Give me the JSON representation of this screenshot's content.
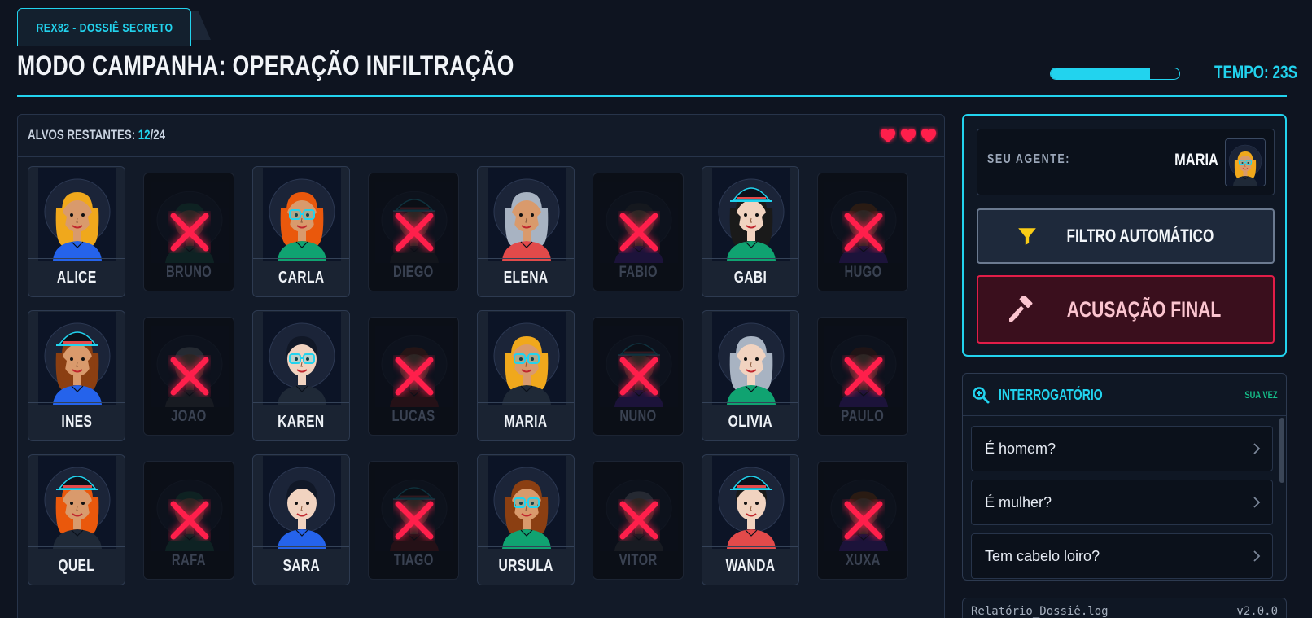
{
  "header": {
    "tab_label": "REX82 - DOSSIÊ SECRETO",
    "title": "MODO CAMPANHA: OPERAÇÃO INFILTRAÇÃO",
    "timer_label": "TEMPO: 23S",
    "timer_fraction": 0.77
  },
  "board": {
    "remaining_label": "ALVOS RESTANTES: ",
    "remaining": "12",
    "total": "/24",
    "lives": 3
  },
  "characters": [
    {
      "name": "ALICE",
      "eliminated": false,
      "hair": "#f0a81c",
      "shirt": "#2563eb",
      "skin": "#d99a6c",
      "glasses": false,
      "hat": false,
      "long": true
    },
    {
      "name": "BRUNO",
      "eliminated": true,
      "hair": "#1f7a5c",
      "shirt": "#1f7a5c",
      "skin": "#c98d60",
      "glasses": false,
      "hat": false,
      "long": false
    },
    {
      "name": "CARLA",
      "eliminated": false,
      "hair": "#ea580c",
      "shirt": "#10a371",
      "skin": "#d99a6c",
      "glasses": true,
      "hat": false,
      "long": true
    },
    {
      "name": "DIEGO",
      "eliminated": true,
      "hair": "#333",
      "shirt": "#333",
      "skin": "#c98d60",
      "glasses": false,
      "hat": true,
      "long": false
    },
    {
      "name": "ELENA",
      "eliminated": false,
      "hair": "#a8b3c2",
      "shirt": "#e24a4a",
      "skin": "#d99a6c",
      "glasses": false,
      "hat": false,
      "long": true
    },
    {
      "name": "FABIO",
      "eliminated": true,
      "hair": "#444",
      "shirt": "#6d28d9",
      "skin": "#c98d60",
      "glasses": false,
      "hat": false,
      "long": false
    },
    {
      "name": "GABI",
      "eliminated": false,
      "hair": "#1a1a1a",
      "shirt": "#10a371",
      "skin": "#f1d3c0",
      "glasses": false,
      "hat": true,
      "long": true
    },
    {
      "name": "HUGO",
      "eliminated": true,
      "hair": "#b45309",
      "shirt": "#6d28d9",
      "skin": "#c98d60",
      "glasses": false,
      "hat": false,
      "long": false
    },
    {
      "name": "INES",
      "eliminated": false,
      "hair": "#8b3f12",
      "shirt": "#2563eb",
      "skin": "#d99a6c",
      "glasses": false,
      "hat": true,
      "long": true
    },
    {
      "name": "JOAO",
      "eliminated": true,
      "hair": "#9ca3af",
      "shirt": "#555",
      "skin": "#c98d60",
      "glasses": false,
      "hat": false,
      "long": false
    },
    {
      "name": "KAREN",
      "eliminated": false,
      "hair": "#111827",
      "shirt": "#1f2937",
      "skin": "#f1d3c0",
      "glasses": true,
      "hat": false,
      "long": false
    },
    {
      "name": "LUCAS",
      "eliminated": true,
      "hair": "#9a3412",
      "shirt": "#991b1b",
      "skin": "#c98d60",
      "glasses": false,
      "hat": false,
      "long": false
    },
    {
      "name": "MARIA",
      "eliminated": false,
      "hair": "#f0a81c",
      "shirt": "#1f2937",
      "skin": "#d99a6c",
      "glasses": true,
      "hat": false,
      "long": true
    },
    {
      "name": "NUNO",
      "eliminated": true,
      "hair": "#333",
      "shirt": "#6d28d9",
      "skin": "#c98d60",
      "glasses": false,
      "hat": true,
      "long": false
    },
    {
      "name": "OLIVIA",
      "eliminated": false,
      "hair": "#a8b3c2",
      "shirt": "#10a371",
      "skin": "#f1d3c0",
      "glasses": false,
      "hat": false,
      "long": true
    },
    {
      "name": "PAULO",
      "eliminated": true,
      "hair": "#7c2d12",
      "shirt": "#6d28d9",
      "skin": "#c98d60",
      "glasses": false,
      "hat": false,
      "long": false
    },
    {
      "name": "QUEL",
      "eliminated": false,
      "hair": "#ea580c",
      "shirt": "#1f2937",
      "skin": "#d99a6c",
      "glasses": false,
      "hat": true,
      "long": true
    },
    {
      "name": "RAFA",
      "eliminated": true,
      "hair": "#1f7a5c",
      "shirt": "#1f7a5c",
      "skin": "#c98d60",
      "glasses": false,
      "hat": false,
      "long": false
    },
    {
      "name": "SARA",
      "eliminated": false,
      "hair": "#111827",
      "shirt": "#2563eb",
      "skin": "#f1d3c0",
      "glasses": false,
      "hat": false,
      "long": false
    },
    {
      "name": "TIAGO",
      "eliminated": true,
      "hair": "#333",
      "shirt": "#991b1b",
      "skin": "#c98d60",
      "glasses": false,
      "hat": true,
      "long": false
    },
    {
      "name": "URSULA",
      "eliminated": false,
      "hair": "#8b3f12",
      "shirt": "#10a371",
      "skin": "#d99a6c",
      "glasses": true,
      "hat": false,
      "long": true
    },
    {
      "name": "VITOR",
      "eliminated": true,
      "hair": "#9ca3af",
      "shirt": "#555",
      "skin": "#c98d60",
      "glasses": false,
      "hat": false,
      "long": false
    },
    {
      "name": "WANDA",
      "eliminated": false,
      "hair": "#1a1a1a",
      "shirt": "#e24a4a",
      "skin": "#f1d3c0",
      "glasses": false,
      "hat": true,
      "long": false
    },
    {
      "name": "XUXA",
      "eliminated": true,
      "hair": "#b45309",
      "shirt": "#6d28d9",
      "skin": "#c98d60",
      "glasses": false,
      "hat": false,
      "long": false
    }
  ],
  "agent": {
    "label": "SEU AGENTE:",
    "name": "MARIA"
  },
  "actions": {
    "filter_label": "FILTRO AUTOMÁTICO",
    "accuse_label": "ACUSAÇÃO FINAL"
  },
  "interrogation": {
    "title": "INTERROGATÓRIO",
    "turn": "SUA VEZ",
    "questions": [
      "É homem?",
      "É mulher?",
      "Tem cabelo loiro?"
    ]
  },
  "log": {
    "filename": "Relatório_Dossiê.log",
    "version": "v2.0.0"
  },
  "colors": {
    "accent": "#22d3ee",
    "danger": "#e11d48",
    "heart": "#ff1f4b",
    "filter_icon": "#facc15",
    "turn": "#15c08a"
  }
}
